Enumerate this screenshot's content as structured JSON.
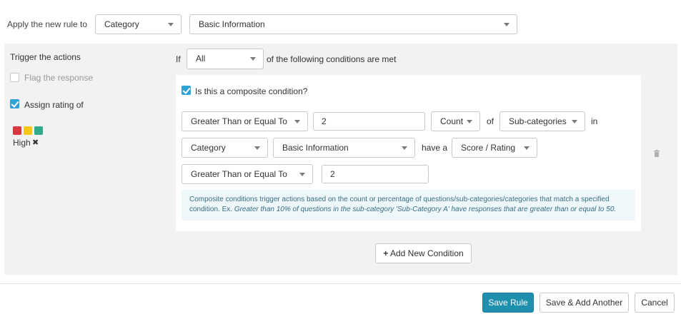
{
  "rule_target": {
    "label": "Apply the new rule to",
    "type_value": "Category",
    "item_value": "Basic Information"
  },
  "actions": {
    "heading": "Trigger the actions",
    "flag_label": "Flag the response",
    "assign_label": "Assign rating of",
    "rating_value": "High",
    "rating_colors": [
      "#d9363e",
      "#f5c518",
      "#2fab8c"
    ]
  },
  "conditions": {
    "if_label": "If",
    "match_value": "All",
    "met_label": "of the following conditions are met",
    "composite_label": "Is this a composite condition?",
    "row1": {
      "operator": "Greater Than or Equal To",
      "value": "2",
      "measure": "Count",
      "of_label": "of",
      "entity": "Sub-categories",
      "in_label": "in"
    },
    "row2": {
      "scope_type": "Category",
      "scope_item": "Basic Information",
      "have_label": "have a",
      "attribute": "Score / Rating"
    },
    "row3": {
      "operator": "Greater Than or Equal To",
      "value": "2"
    },
    "help_text": "Composite conditions trigger actions based on the count or percentage of questions/sub-categories/categories that match a specified condition. Ex.",
    "help_example": "Greater than 10% of questions in the sub-category 'Sub-Category A' have responses that are greater than or equal to 50.",
    "add_condition_label": "Add New Condition"
  },
  "footer": {
    "save_label": "Save Rule",
    "save_add_label": "Save & Add Another",
    "cancel_label": "Cancel"
  },
  "colors": {
    "accent": "#2ea3d6",
    "primary_button": "#1f8fae",
    "panel_bg": "#f2f2f2",
    "help_bg": "#eef8fb"
  }
}
